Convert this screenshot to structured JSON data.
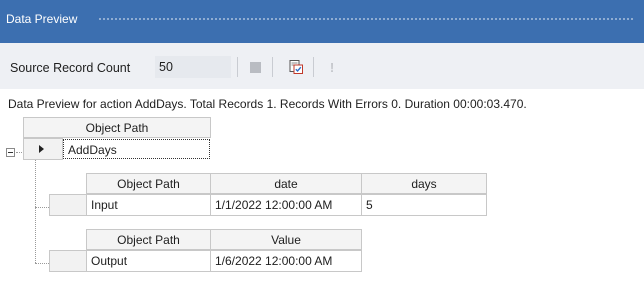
{
  "window": {
    "title": "Data Preview"
  },
  "toolbar": {
    "source_record_count_label": "Source Record Count",
    "source_record_count_value": "50",
    "icons": [
      "stop-icon",
      "preview-records-icon",
      "error-exclamation-icon"
    ]
  },
  "status": {
    "text": "Data Preview for action AddDays. Total Records 1. Records With Errors 0. Duration 00:00:03.470."
  },
  "main_grid": {
    "header": "Object Path",
    "row": "AddDays"
  },
  "input_grid": {
    "headers": [
      "Object Path",
      "date",
      "days"
    ],
    "row": [
      "Input",
      "1/1/2022 12:00:00 AM",
      "5"
    ]
  },
  "output_grid": {
    "headers": [
      "Object Path",
      "Value"
    ],
    "row": [
      "Output",
      "1/6/2022 12:00:00 AM"
    ]
  },
  "colors": {
    "titlebar": "#3c6fb0",
    "toolbar": "#eef0f4",
    "grid_border": "#c8c8c8"
  }
}
